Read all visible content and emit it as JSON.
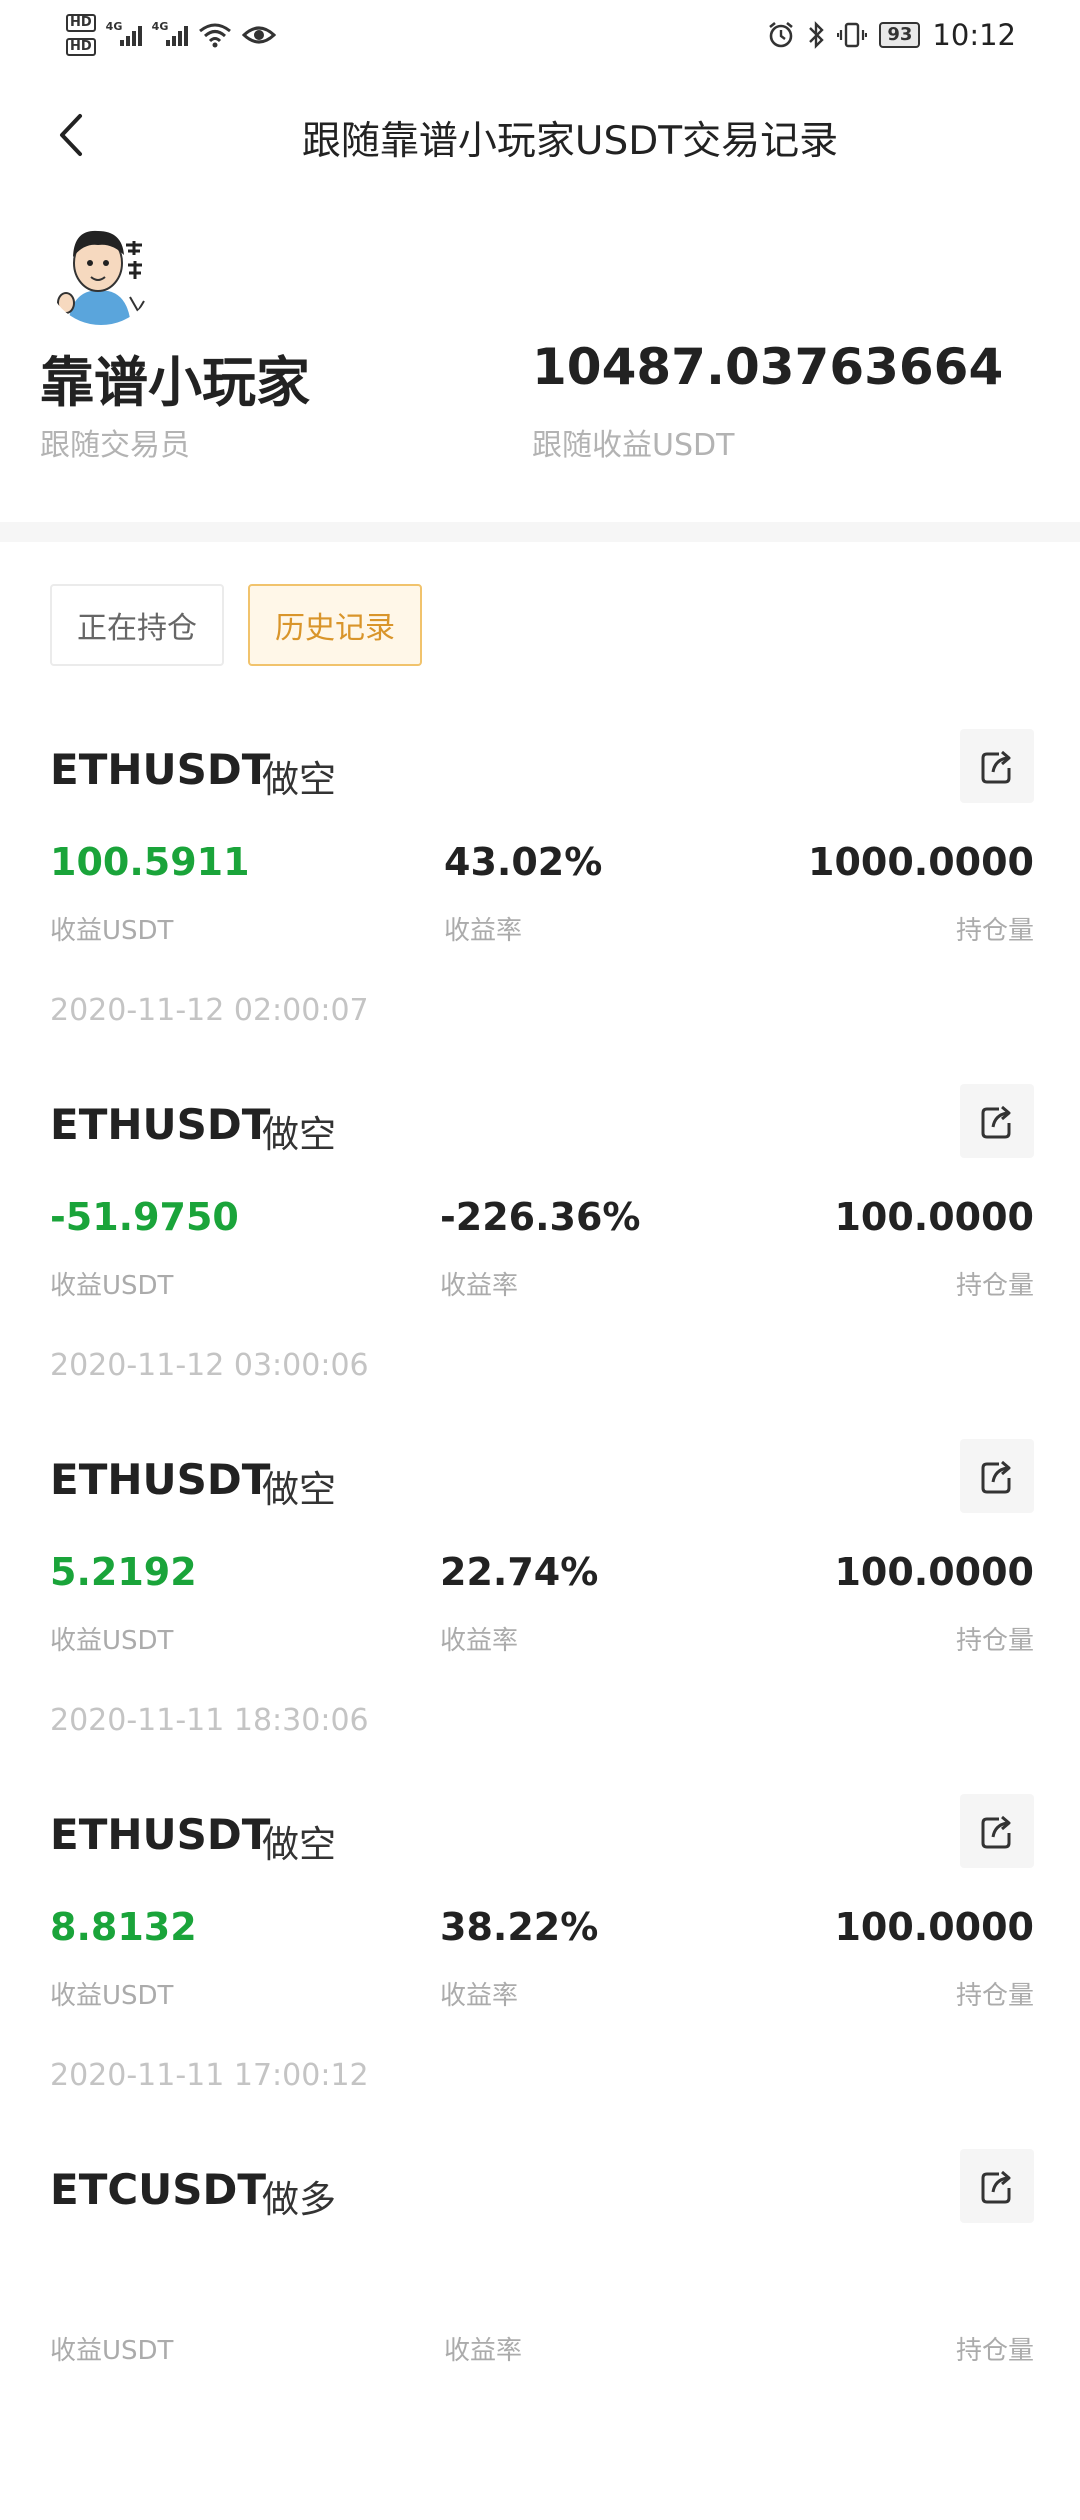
{
  "status_bar": {
    "hd1": "HD",
    "hd2": "HD",
    "net1": "4G",
    "net2": "4G",
    "battery": "93",
    "time": "10:12"
  },
  "header": {
    "title": "跟随靠谱小玩家USDT交易记录"
  },
  "profile": {
    "trader_name": "靠谱小玩家",
    "trader_label": "跟随交易员",
    "follow_profit": "10487.03763664",
    "follow_profit_label": "跟随收益USDT"
  },
  "tabs": [
    {
      "label": "正在持仓"
    },
    {
      "label": "历史记录"
    }
  ],
  "labels": {
    "profit": "收益USDT",
    "rate": "收益率",
    "position": "持仓量"
  },
  "records": [
    {
      "pair": "ETHUSDT",
      "side": "做空",
      "profit": "100.5911",
      "rate": "43.02%",
      "position": "1000.0000",
      "time": "2020-11-12 02:00:07"
    },
    {
      "pair": "ETHUSDT",
      "side": "做空",
      "profit": "-51.9750",
      "rate": "-226.36%",
      "position": "100.0000",
      "time": "2020-11-12 03:00:06"
    },
    {
      "pair": "ETHUSDT",
      "side": "做空",
      "profit": "5.2192",
      "rate": "22.74%",
      "position": "100.0000",
      "time": "2020-11-11 18:30:06"
    },
    {
      "pair": "ETHUSDT",
      "side": "做空",
      "profit": "8.8132",
      "rate": "38.22%",
      "position": "100.0000",
      "time": "2020-11-11 17:00:12"
    },
    {
      "pair": "ETCUSDT",
      "side": "做多",
      "profit": "",
      "rate": "",
      "position": "",
      "time": ""
    }
  ],
  "colors": {
    "profit_green": "#1aa43a",
    "tab_active_text": "#d9952a",
    "tab_active_border": "#f1c36c"
  }
}
